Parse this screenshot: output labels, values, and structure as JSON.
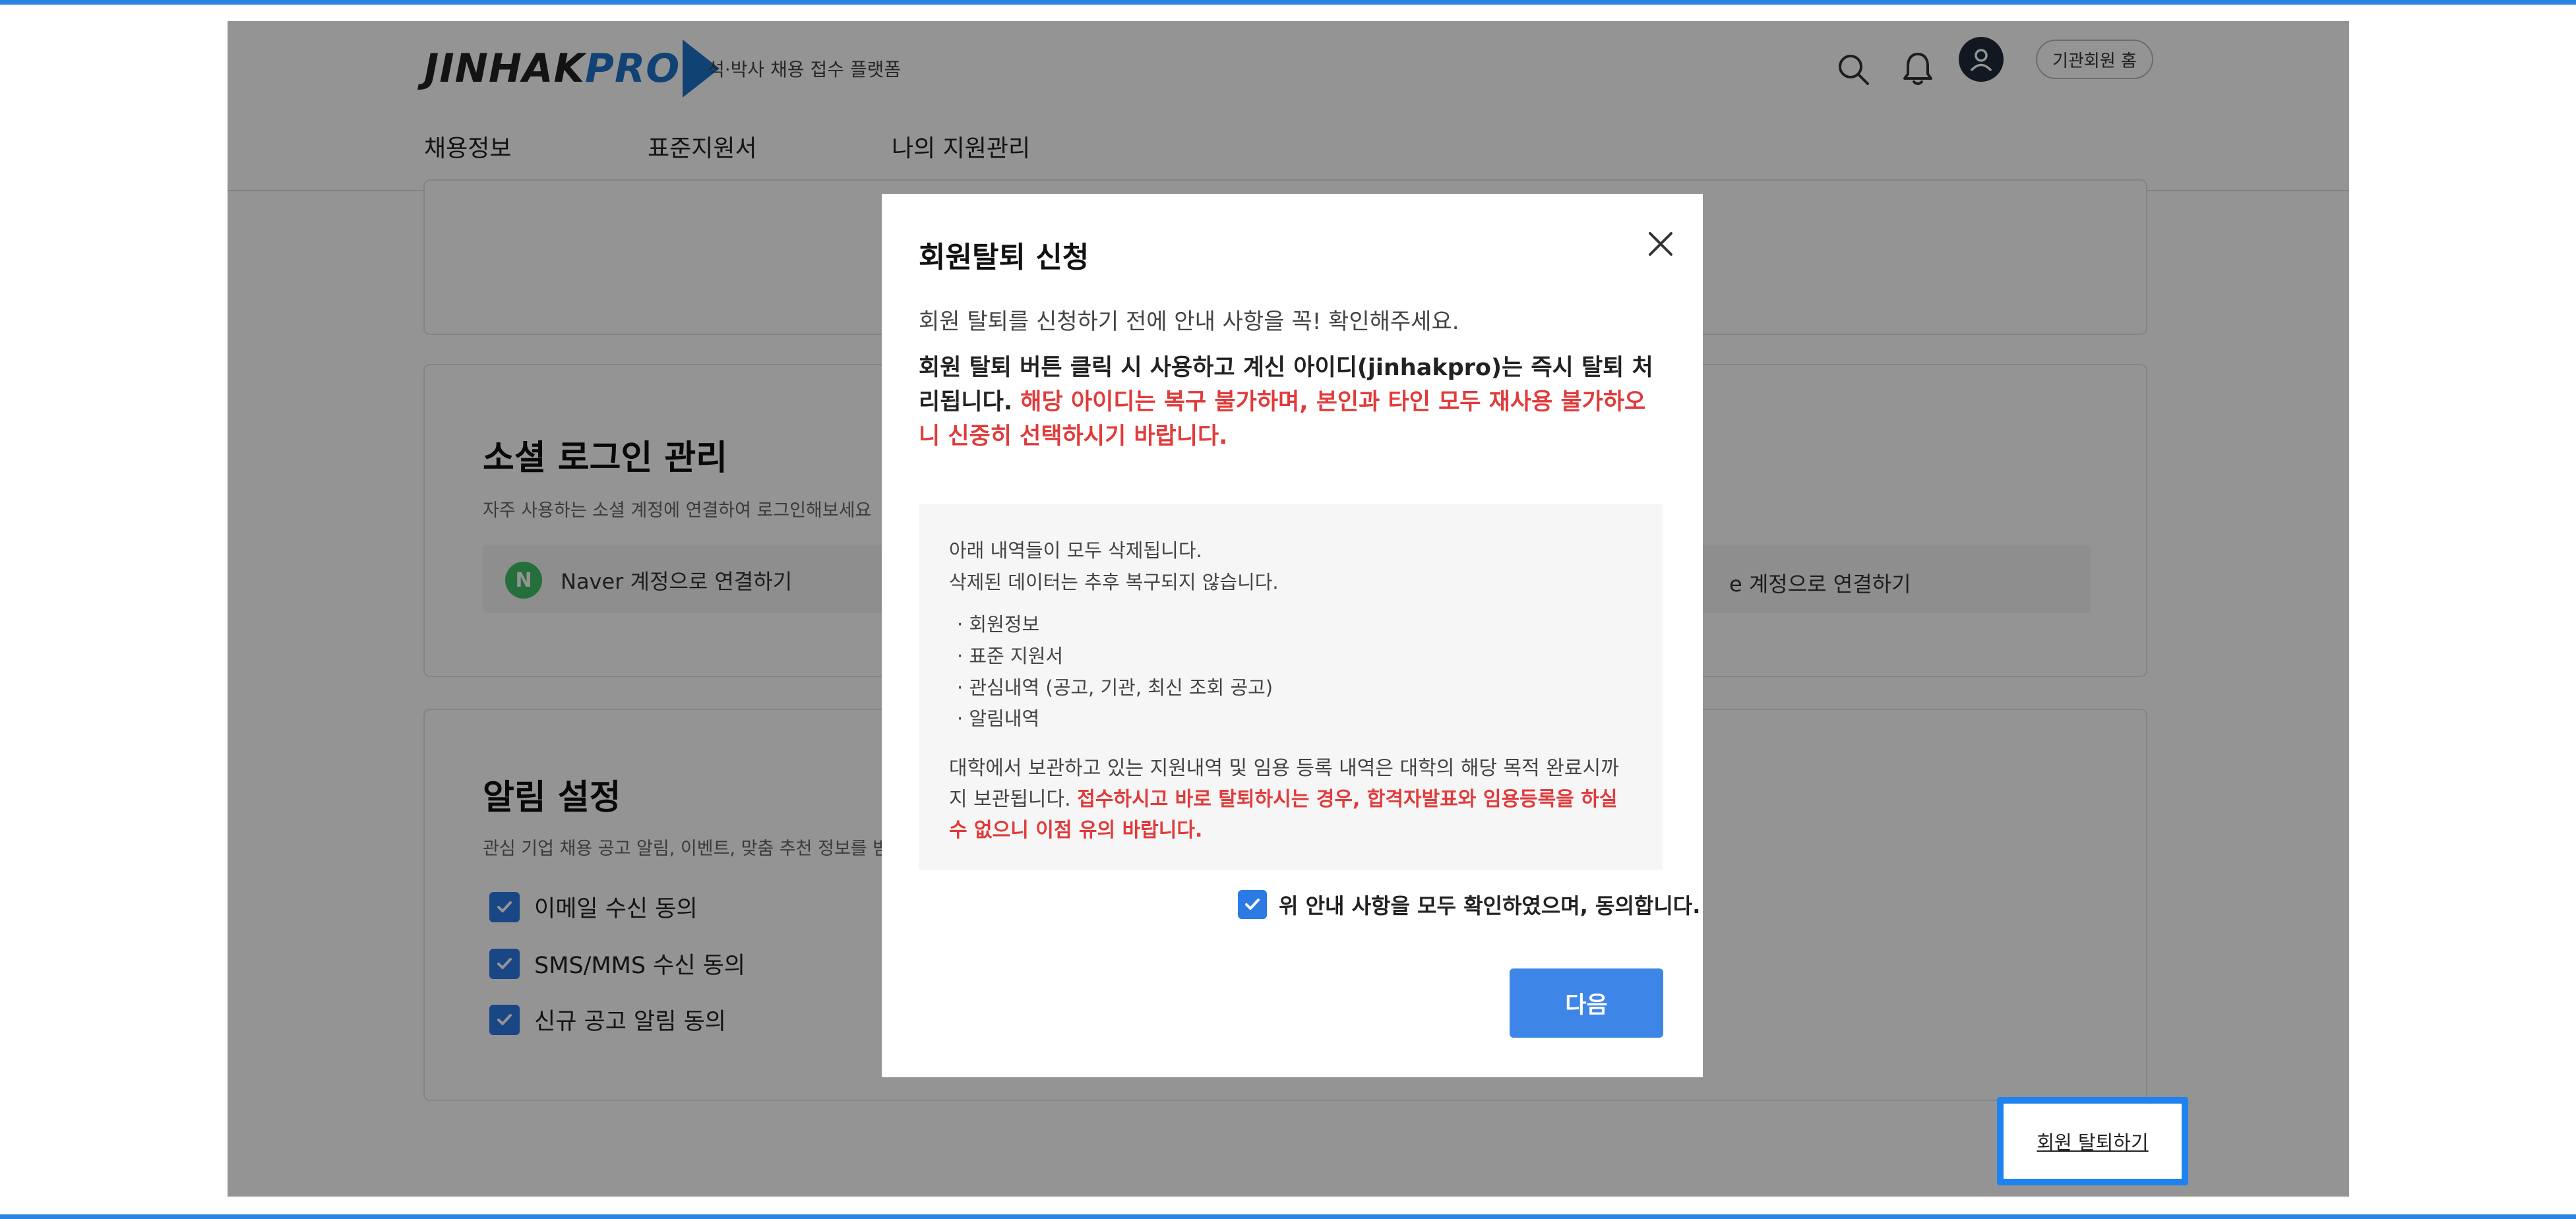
{
  "header": {
    "logo_text": "JINHAK",
    "logo_text_pro": "PRO",
    "tagline": "석·박사 채용 접수 플랫폼",
    "home_button": "기관회원 홈"
  },
  "nav": {
    "items": [
      {
        "label": "채용정보"
      },
      {
        "label": "표준지원서"
      },
      {
        "label": "나의 지원관리"
      }
    ]
  },
  "social": {
    "title": "소셜 로그인 관리",
    "desc": "자주 사용하는 소셜 계정에 연결하여 로그인해보세요",
    "naver_badge": "N",
    "naver_label": "Naver 계정으로 연결하기",
    "right_label": "e 계정으로 연결하기"
  },
  "alerts": {
    "title": "알림 설정",
    "desc": "관심 기업 채용 공고 알림, 이벤트, 맞춤 추천 정보를 받",
    "options": [
      {
        "label": "이메일 수신 동의"
      },
      {
        "label": "SMS/MMS 수신 동의"
      },
      {
        "label": "신규 공고 알림 동의"
      }
    ]
  },
  "withdraw_link": "회원 탈퇴하기",
  "modal": {
    "title": "회원탈퇴 신청",
    "lead": "회원 탈퇴를 신청하기 전에 안내 사항을 꼭! 확인해주세요.",
    "warn_normal": "회원 탈퇴 버튼 클릭 시 사용하고 계신 아이디(jinhakpro)는 즉시 탈퇴 처리됩니다. ",
    "warn_red": "해당 아이디는 복구 불가하며, 본인과 타인 모두 재사용 불가하오니 신중히 선택하시기 바랍니다.",
    "info": {
      "line1": "아래 내역들이 모두 삭제됩니다.",
      "line2": "삭제된 데이터는 추후 복구되지 않습니다.",
      "bullets": [
        {
          "text": "·  회원정보"
        },
        {
          "text": "·  표준 지원서"
        },
        {
          "text": "·  관심내역 (공고, 기관, 최신 조회 공고)"
        },
        {
          "text": "·  알림내역"
        }
      ],
      "foot_normal": "대학에서 보관하고 있는 지원내역 및 임용 등록 내역은 대학의 해당 목적 완료시까지 보관됩니다. ",
      "foot_red": "접수하시고 바로 탈퇴하시는 경우, 합격자발표와 임용등록을 하실 수 없으니 이점 유의 바랍니다."
    },
    "agree_label": "위 안내 사항을 모두 확인하였으며, 동의합니다.",
    "next_button": "다음"
  },
  "colors": {
    "accent": "#2c7be5",
    "warning": "#e03b3b",
    "brand": "#1e73c8"
  }
}
